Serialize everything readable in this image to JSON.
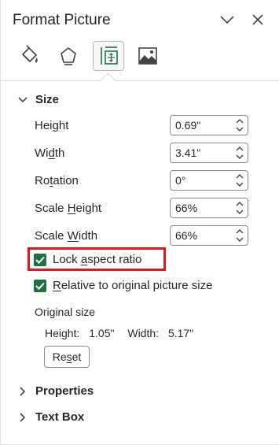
{
  "pane": {
    "title": "Format Picture",
    "tabs": [
      {
        "name": "fill-line-icon"
      },
      {
        "name": "effects-icon"
      },
      {
        "name": "size-properties-icon",
        "active": true
      },
      {
        "name": "picture-icon"
      }
    ]
  },
  "size": {
    "header": "Size",
    "height": {
      "label_pre": "Hei",
      "label_u": "g",
      "label_post": "ht",
      "value": "0.69\""
    },
    "width": {
      "label_pre": "Wi",
      "label_u": "d",
      "label_post": "th",
      "value": "3.41\""
    },
    "rotation": {
      "label_pre": "Ro",
      "label_u": "t",
      "label_post": "ation",
      "value": "0°"
    },
    "scale_height": {
      "label_pre": "Scale ",
      "label_u": "H",
      "label_post": "eight",
      "value": "66%"
    },
    "scale_width": {
      "label_pre": "Scale ",
      "label_u": "W",
      "label_post": "idth",
      "value": "66%"
    },
    "lock_aspect": {
      "label_pre": "Lock ",
      "label_u": "a",
      "label_post": "spect ratio",
      "checked": true
    },
    "relative": {
      "label_pre": "",
      "label_u": "R",
      "label_post": "elative to original picture size",
      "checked": true
    },
    "original": {
      "title": "Original size",
      "height_label": "Height:",
      "height_value": "1.05\"",
      "width_label": "Width:",
      "width_value": "5.17\""
    },
    "reset": {
      "label_pre": "Re",
      "label_u": "s",
      "label_post": "et"
    }
  },
  "sections": {
    "properties": "Properties",
    "text_box": "Text Box"
  },
  "colors": {
    "checkbox": "#1e7145",
    "highlight": "#e0191e"
  }
}
